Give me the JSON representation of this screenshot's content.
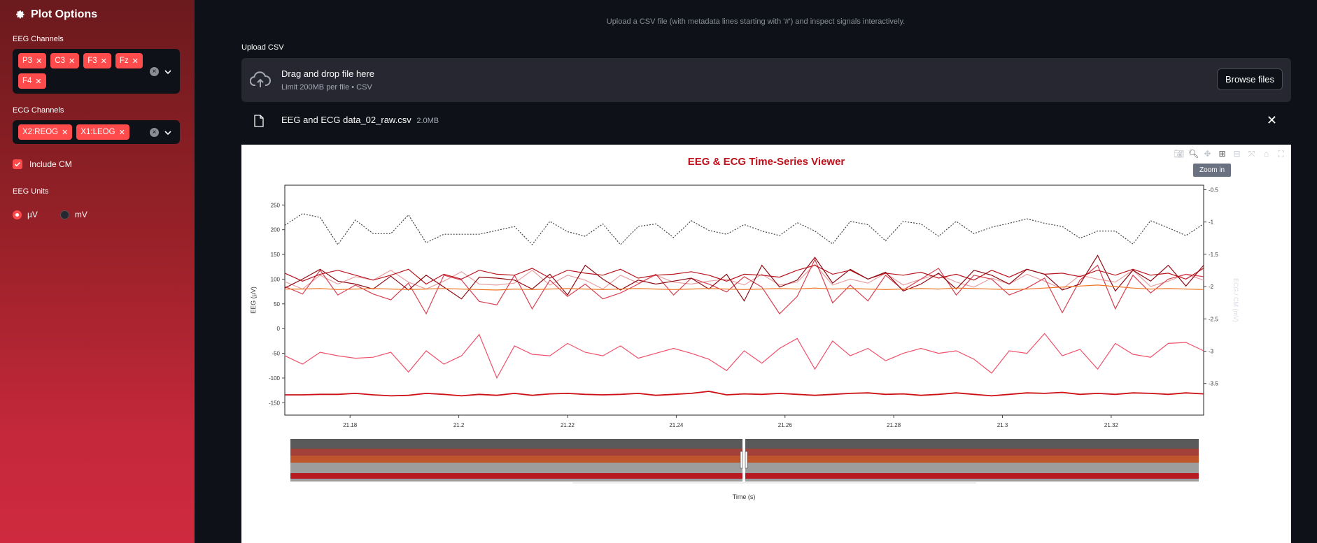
{
  "sidebar": {
    "title": "Plot Options",
    "eeg_label": "EEG Channels",
    "eeg_tags": [
      "P3",
      "C3",
      "F3",
      "Fz",
      "F4"
    ],
    "ecg_label": "ECG Channels",
    "ecg_tags": [
      "X2:REOG",
      "X1:LEOG"
    ],
    "include_cm": "Include CM",
    "units_label": "EEG Units",
    "unit_uv": "µV",
    "unit_mv": "mV",
    "accent": "#ff4b4b"
  },
  "main": {
    "subtitle": "Upload a CSV file (with metadata lines starting with '#') and inspect signals interactively.",
    "upload_label": "Upload CSV",
    "dz_main": "Drag and drop file here",
    "dz_sub": "Limit 200MB per file • CSV",
    "browse": "Browse files",
    "file_name": "EEG and ECG data_02_raw.csv",
    "file_size": "2.0MB"
  },
  "plot": {
    "tooltip": "Zoom in"
  },
  "chart_data": {
    "type": "line",
    "title": "EEG & ECG Time-Series Viewer",
    "xlabel": "Time (s)",
    "ylabel": "EEG (µV)",
    "y2label": "ECG / CM (mV)",
    "xlim": [
      21.168,
      21.337
    ],
    "ylim": [
      -175,
      290
    ],
    "y2lim": [
      -3.99,
      -0.43
    ],
    "x_ticks": [
      21.18,
      21.2,
      21.22,
      21.24,
      21.26,
      21.28,
      21.3,
      21.32
    ],
    "y_ticks": [
      -150,
      -100,
      -50,
      0,
      50,
      100,
      150,
      200,
      250
    ],
    "y2_ticks": [
      -3.5,
      -3,
      -2.5,
      -2,
      -1.5,
      -1,
      -0.5
    ],
    "series": [
      {
        "color": "#444444",
        "dash": true,
        "axis": "y2",
        "values": [
          -1.05,
          -0.87,
          -0.93,
          -1.35,
          -0.97,
          -1.18,
          -1.18,
          -0.89,
          -1.32,
          -1.19,
          -1.19,
          -1.19,
          -1.13,
          -1.07,
          -1.35,
          -0.99,
          -1.15,
          -1.22,
          -1.03,
          -1.35,
          -1.07,
          -1.03,
          -1.24,
          -0.98,
          -1.13,
          -1.19,
          -1.04,
          -1.14,
          -1.21,
          -1.01,
          -1.14,
          -1.34,
          -0.99,
          -1.04,
          -1.29,
          -0.99,
          -1.03,
          -1.22,
          -0.99,
          -1.18,
          -1.08,
          -1.02,
          -0.95,
          -1.02,
          -1.07,
          -1.25,
          -1.14,
          -1.14,
          -1.34,
          -0.98,
          -1.09,
          -1.21,
          -1.03
        ]
      },
      {
        "color": "#e8a0a0",
        "dash": false,
        "axis": "y",
        "values": [
          95,
          80,
          108,
          90,
          105,
          98,
          118,
          94,
          80,
          96,
          115,
          90,
          88,
          92,
          118,
          88,
          108,
          98,
          80,
          108,
          92,
          108,
          94,
          90,
          96,
          100,
          88,
          110,
          88,
          94,
          130,
          88,
          100,
          92,
          112,
          88,
          100,
          110,
          94,
          84,
          102,
          90,
          110,
          96,
          80,
          108,
          100,
          94,
          118,
          85,
          96,
          110,
          98
        ]
      },
      {
        "color": "#d84050",
        "dash": false,
        "axis": "y",
        "values": [
          85,
          70,
          118,
          68,
          88,
          70,
          58,
          92,
          30,
          108,
          98,
          55,
          48,
          108,
          40,
          98,
          65,
          90,
          60,
          72,
          90,
          110,
          68,
          102,
          90,
          74,
          105,
          84,
          30,
          65,
          140,
          52,
          88,
          56,
          108,
          78,
          100,
          122,
          68,
          108,
          100,
          68,
          82,
          102,
          32,
          98,
          128,
          40,
          108,
          72,
          100,
          110,
          105
        ]
      },
      {
        "color": "#b8141e",
        "dash": false,
        "axis": "y",
        "values": [
          112,
          96,
          110,
          118,
          108,
          98,
          108,
          120,
          90,
          110,
          100,
          118,
          110,
          108,
          122,
          102,
          118,
          112,
          108,
          120,
          102,
          108,
          110,
          115,
          108,
          96,
          110,
          108,
          104,
          118,
          128,
          110,
          118,
          100,
          112,
          108,
          114,
          102,
          110,
          98,
          118,
          104,
          120,
          110,
          112,
          105,
          118,
          108,
          120,
          108,
          112,
          100,
          122
        ]
      },
      {
        "color": "#8e0c14",
        "dash": false,
        "axis": "y",
        "values": [
          82,
          100,
          120,
          96,
          90,
          80,
          106,
          78,
          108,
          84,
          60,
          104,
          102,
          98,
          80,
          110,
          68,
          128,
          100,
          78,
          98,
          90,
          96,
          102,
          80,
          110,
          56,
          128,
          84,
          98,
          144,
          92,
          120,
          100,
          114,
          76,
          90,
          112,
          80,
          118,
          108,
          90,
          120,
          110,
          78,
          90,
          148,
          76,
          118,
          96,
          128,
          86,
          128
        ]
      },
      {
        "color": "#ee7420",
        "dash": false,
        "axis": "y",
        "values": [
          80,
          80,
          81,
          79,
          80,
          81,
          80,
          79,
          80,
          81,
          80,
          79,
          78,
          80,
          79,
          80,
          81,
          80,
          79,
          80,
          81,
          80,
          79,
          80,
          81,
          80,
          79,
          80,
          81,
          80,
          82,
          80,
          81,
          80,
          79,
          80,
          81,
          80,
          82,
          81,
          80,
          79,
          80,
          82,
          84,
          86,
          88,
          85,
          82,
          80,
          81,
          80,
          79
        ]
      },
      {
        "color": "#f0506a",
        "dash": false,
        "axis": "y",
        "values": [
          -55,
          -72,
          -48,
          -55,
          -60,
          -58,
          -48,
          -88,
          -45,
          -72,
          -55,
          -12,
          -100,
          -35,
          -52,
          -55,
          -30,
          -48,
          -55,
          -35,
          -60,
          -50,
          -40,
          -50,
          -62,
          -85,
          -45,
          -70,
          -40,
          -20,
          -82,
          -25,
          -55,
          -40,
          -65,
          -50,
          -40,
          -50,
          -45,
          -62,
          -90,
          -45,
          -50,
          -10,
          -55,
          -42,
          -82,
          -30,
          -52,
          -58,
          -30,
          -28,
          -45
        ]
      },
      {
        "color": "#cc1016",
        "dash": false,
        "axis": "y",
        "values": [
          -134,
          -134,
          -133,
          -133,
          -131,
          -134,
          -136,
          -135,
          -131,
          -133,
          -136,
          -133,
          -135,
          -131,
          -135,
          -132,
          -131,
          -133,
          -134,
          -133,
          -131,
          -135,
          -133,
          -131,
          -127,
          -134,
          -132,
          -133,
          -131,
          -133,
          -135,
          -133,
          -131,
          -130,
          -133,
          -132,
          -135,
          -133,
          -130,
          -133,
          -136,
          -133,
          -130,
          -131,
          -129,
          -133,
          -131,
          -133,
          -130,
          -131,
          -133,
          -130,
          -132
        ]
      }
    ]
  }
}
